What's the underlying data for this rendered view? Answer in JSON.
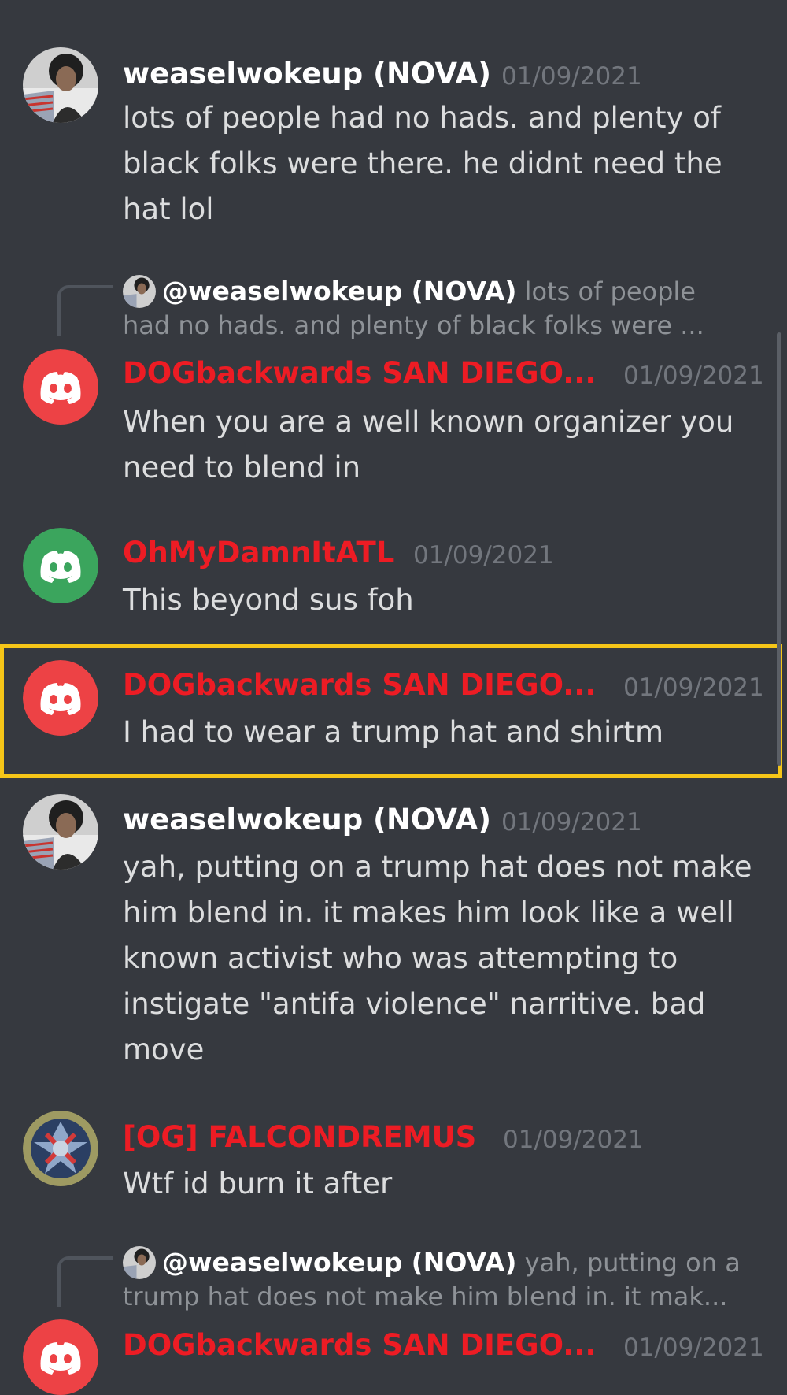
{
  "colors": {
    "background": "#36393f",
    "highlight": "#f5c518",
    "red_username": "#ed1c24",
    "discord_red": "#ed4245",
    "discord_green": "#3ba55d"
  },
  "messages": [
    {
      "username": "weaselwokeup (NOVA)",
      "timestamp": "01/09/2021",
      "text": "lots of people had no hads. and plenty of black folks were there. he didnt need the hat lol",
      "avatar": "photo-avatar-icon"
    },
    {
      "reply": {
        "username": "@weaselwokeup (NOVA)",
        "preview_line1": " lots of people",
        "preview_line2": "had no hads. and plenty of black folks were ..."
      },
      "username": "DOGbackwards SAN DIEGO...",
      "timestamp": "01/09/2021",
      "text": "When you are a well known organizer you need to blend in",
      "avatar": "discord-red-icon"
    },
    {
      "username": "OhMyDamnItATL",
      "timestamp": "01/09/2021",
      "text": "This beyond sus foh",
      "avatar": "discord-green-icon"
    },
    {
      "username": "DOGbackwards SAN DIEGO...",
      "timestamp": "01/09/2021",
      "text": "I had to wear a trump hat and shirtm",
      "avatar": "discord-red-icon",
      "highlighted": true
    },
    {
      "username": "weaselwokeup (NOVA)",
      "timestamp": "01/09/2021",
      "text": "yah, putting on a trump hat does not make him blend in. it makes him look like a well known activist who was attempting to instigate \"antifa violence\" narritive. bad move",
      "avatar": "photo-avatar-icon"
    },
    {
      "username": "[OG] FALCONDREMUS",
      "timestamp": "01/09/2021",
      "text": "Wtf id burn it after",
      "avatar": "emblem-avatar-icon"
    },
    {
      "reply": {
        "username": "@weaselwokeup (NOVA)",
        "preview_line1": " yah, putting on a",
        "preview_line2": "trump hat does not make him blend in. it mak..."
      },
      "username": "DOGbackwards SAN DIEGO...",
      "timestamp": "01/09/2021",
      "text": "",
      "avatar": "discord-red-icon"
    }
  ]
}
